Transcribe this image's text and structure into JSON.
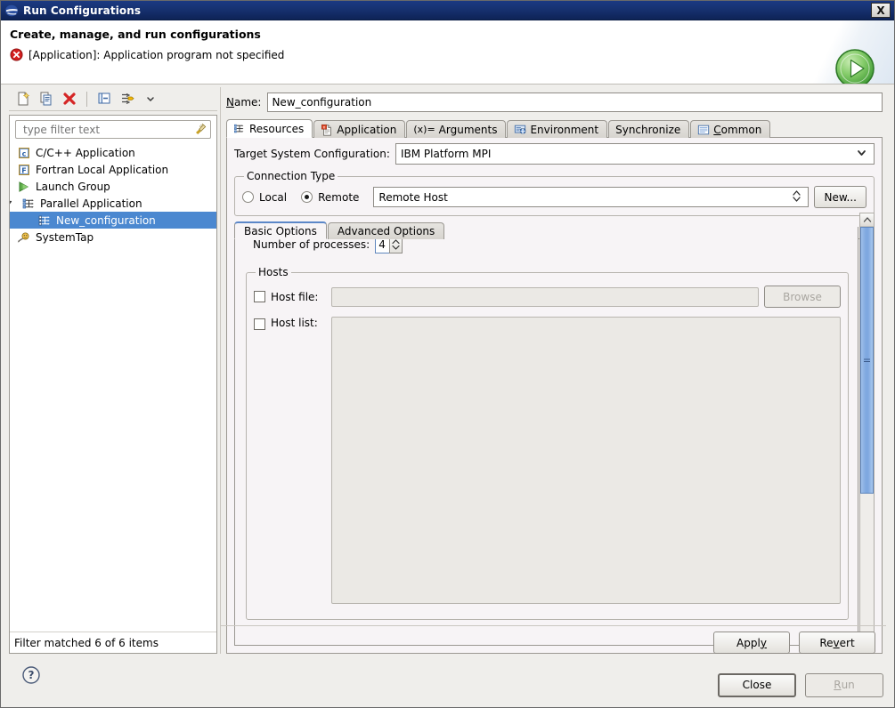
{
  "window": {
    "title": "Run Configurations",
    "icon": "eclipse-icon",
    "close_label": "X"
  },
  "banner": {
    "title": "Create, manage, and run configurations",
    "message": "[Application]: Application program not specified",
    "message_icon": "error-icon",
    "run_icon": "run-green-play-icon"
  },
  "left_panel": {
    "toolbar": [
      {
        "name": "new-configuration-icon",
        "tooltip": "New launch configuration"
      },
      {
        "name": "duplicate-configuration-icon",
        "tooltip": "Duplicate"
      },
      {
        "name": "delete-configuration-icon",
        "tooltip": "Delete"
      },
      {
        "name": "collapse-all-icon",
        "tooltip": "Collapse All"
      },
      {
        "name": "filter-icon",
        "tooltip": "Filter"
      },
      {
        "name": "chevron-down-icon",
        "tooltip": "View Menu"
      }
    ],
    "filter": {
      "placeholder": "type filter text",
      "value": "",
      "clear_icon": "clear-filter-icon"
    },
    "tree": [
      {
        "label": "C/C++ Application",
        "icon": "c-application-icon",
        "level": 0,
        "selected": false,
        "twisty": ""
      },
      {
        "label": "Fortran Local Application",
        "icon": "fortran-application-icon",
        "level": 0,
        "selected": false,
        "twisty": ""
      },
      {
        "label": "Launch Group",
        "icon": "launch-group-icon",
        "level": 0,
        "selected": false,
        "twisty": ""
      },
      {
        "label": "Parallel Application",
        "icon": "parallel-application-icon",
        "level": 0,
        "selected": false,
        "twisty": "expanded"
      },
      {
        "label": "New_configuration",
        "icon": "parallel-application-icon",
        "level": 1,
        "selected": true,
        "twisty": ""
      },
      {
        "label": "SystemTap",
        "icon": "systemtap-icon",
        "level": 0,
        "selected": false,
        "twisty": ""
      }
    ],
    "filter_status": "Filter matched 6 of 6 items",
    "help_icon": "help-icon"
  },
  "right_panel": {
    "name_label": "Name:",
    "name_label_mnemonic": "N",
    "name_value": "New_configuration",
    "tabs": [
      {
        "label": "Resources",
        "icon": "resources-icon",
        "active": true
      },
      {
        "label": "Application",
        "icon": "application-icon",
        "active": false
      },
      {
        "label": "Arguments",
        "icon": "arguments-icon",
        "icon_text": "(x)=",
        "active": false
      },
      {
        "label": "Environment",
        "icon": "environment-icon",
        "active": false
      },
      {
        "label": "Synchronize",
        "icon": "",
        "active": false
      },
      {
        "label": "Common",
        "icon": "common-icon",
        "active": false,
        "mnemonic": "C"
      }
    ],
    "target_system": {
      "label": "Target System Configuration:",
      "value": "IBM Platform MPI",
      "arrow_icon": "chevron-down-icon"
    },
    "connection_type": {
      "legend": "Connection Type",
      "local_label": "Local",
      "remote_label": "Remote",
      "selected": "Remote",
      "remote_host_value": "Remote Host",
      "remote_host_arrow_icon": "up-down-arrow-icon",
      "new_button": "New..."
    },
    "inner_tabs": [
      {
        "label": "Basic Options",
        "active": true
      },
      {
        "label": "Advanced Options",
        "active": false
      }
    ],
    "basic_options": {
      "processes_label": "Number of processes:",
      "processes_value": "4",
      "processes_spinner_icon": "up-down-spinner-icon",
      "hosts_legend": "Hosts",
      "host_file_label": "Host file:",
      "host_file_checked": false,
      "host_file_value": "",
      "browse_button": "Browse",
      "browse_enabled": false,
      "host_list_label": "Host list:",
      "host_list_checked": false,
      "host_list_value": ""
    },
    "scrollbar": {
      "up_icon": "scroll-up-icon",
      "down_icon": "scroll-down-icon",
      "thumb_grip_icon": "scroll-grip-icon"
    },
    "apply_button": "Apply",
    "apply_mnemonic": "y",
    "revert_button": "Revert",
    "revert_mnemonic": "v"
  },
  "footer": {
    "close_button": "Close",
    "close_default": true,
    "run_button": "Run",
    "run_mnemonic": "R",
    "run_enabled": false
  },
  "colors": {
    "titlebar": "#16306e",
    "selection": "#4b88d0",
    "panel_bg": "#efeeeb",
    "tab_panel_bg": "#f7f4f6",
    "error": "#d32020",
    "run_green": "#5ab34a",
    "scrollbar_thumb": "#7fa8e0"
  }
}
